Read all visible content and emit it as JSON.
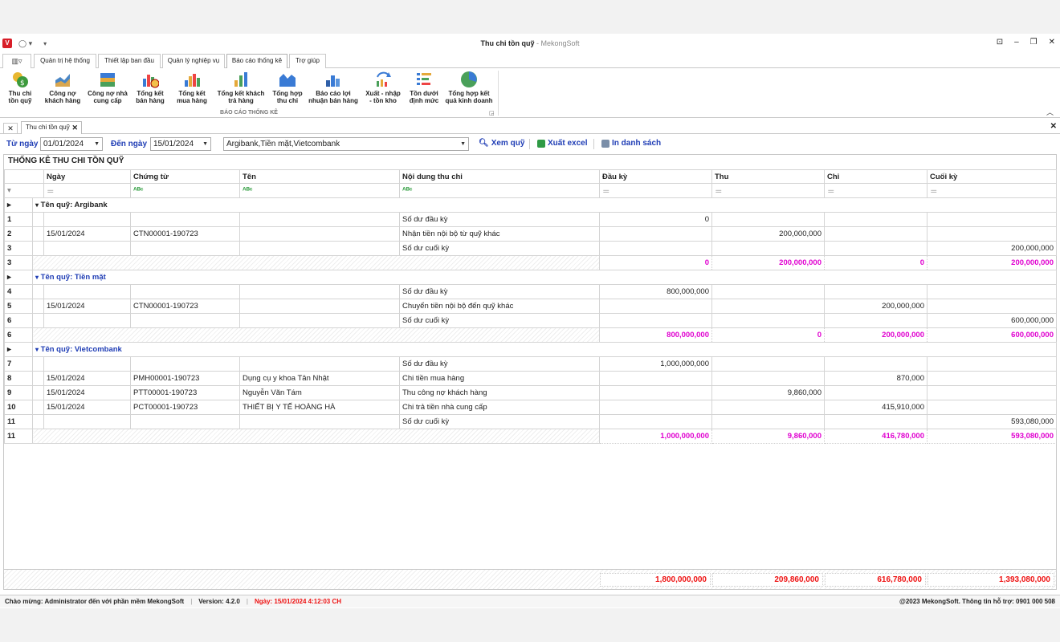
{
  "window": {
    "title": "Thu chi tồn quỹ",
    "app_name": "- MekongSoft"
  },
  "ribbon_tabs": [
    "Quản trị hệ thống",
    "Thiết lập ban đầu",
    "Quản lý nghiệp vụ",
    "Báo cáo thống kê",
    "Trợ giúp"
  ],
  "ribbon": {
    "group_label": "BÁO CÁO THỐNG KÊ",
    "buttons": [
      {
        "label": "Thu chi\ntồn quỹ"
      },
      {
        "label": "Công nợ\nkhách hàng"
      },
      {
        "label": "Công nợ nhà\ncung cấp"
      },
      {
        "label": "Tổng kết\nbán hàng"
      },
      {
        "label": "Tổng kết\nmua hàng"
      },
      {
        "label": "Tổng kết khách\ntrả hàng"
      },
      {
        "label": "Tổng hợp\nthu chi"
      },
      {
        "label": "Báo cáo lợi\nnhuận bán hàng"
      },
      {
        "label": "Xuất - nhập\n- tồn kho"
      },
      {
        "label": "Tồn dưới\nđịnh mức"
      },
      {
        "label": "Tổng hợp kết\nquả kinh doanh"
      }
    ]
  },
  "doc_tab": "Thu chi tồn quỹ",
  "filter": {
    "from_label": "Từ ngày",
    "from_value": "01/01/2024",
    "to_label": "Đến ngày",
    "to_value": "15/01/2024",
    "funds_value": "Argibank,Tiền mặt,Vietcombank",
    "view_label": "Xem quỹ",
    "excel_label": "Xuất excel",
    "print_label": "In danh sách"
  },
  "grid": {
    "title": "THỐNG KÊ THU CHI TỒN QUỸ",
    "columns": [
      "Ngày",
      "Chứng từ",
      "Tên",
      "Nội dung thu chi",
      "Đầu kỳ",
      "Thu",
      "Chi",
      "Cuối kỳ"
    ],
    "groups": [
      {
        "label": "Tên quỹ: Argibank",
        "rows": [
          {
            "n": "1",
            "date": "",
            "doc": "",
            "name": "",
            "content": "Số dư đầu kỳ",
            "open": "0",
            "in": "",
            "out": "",
            "close": ""
          },
          {
            "n": "2",
            "date": "15/01/2024",
            "doc": "CTN00001-190723",
            "name": "",
            "content": "Nhận tiền nội bộ từ quỹ khác",
            "open": "",
            "in": "200,000,000",
            "out": "",
            "close": ""
          },
          {
            "n": "3",
            "date": "",
            "doc": "",
            "name": "",
            "content": "Số dư cuối kỳ",
            "open": "",
            "in": "",
            "out": "",
            "close": "200,000,000"
          }
        ],
        "summary": {
          "n": "3",
          "open": "0",
          "in": "200,000,000",
          "out": "0",
          "close": "200,000,000"
        }
      },
      {
        "label": "Tên quỹ: Tiền mặt",
        "rows": [
          {
            "n": "4",
            "date": "",
            "doc": "",
            "name": "",
            "content": "Số dư đầu kỳ",
            "open": "800,000,000",
            "in": "",
            "out": "",
            "close": ""
          },
          {
            "n": "5",
            "date": "15/01/2024",
            "doc": "CTN00001-190723",
            "name": "",
            "content": "Chuyển tiền nội bộ đến quỹ khác",
            "open": "",
            "in": "",
            "out": "200,000,000",
            "close": ""
          },
          {
            "n": "6",
            "date": "",
            "doc": "",
            "name": "",
            "content": "Số dư cuối kỳ",
            "open": "",
            "in": "",
            "out": "",
            "close": "600,000,000"
          }
        ],
        "summary": {
          "n": "6",
          "open": "800,000,000",
          "in": "0",
          "out": "200,000,000",
          "close": "600,000,000"
        }
      },
      {
        "label": "Tên quỹ: Vietcombank",
        "rows": [
          {
            "n": "7",
            "date": "",
            "doc": "",
            "name": "",
            "content": "Số dư đầu kỳ",
            "open": "1,000,000,000",
            "in": "",
            "out": "",
            "close": ""
          },
          {
            "n": "8",
            "date": "15/01/2024",
            "doc": "PMH00001-190723",
            "name": "Dụng cụ y khoa Tân Nhật",
            "content": "Chi tiền mua hàng",
            "open": "",
            "in": "",
            "out": "870,000",
            "close": ""
          },
          {
            "n": "9",
            "date": "15/01/2024",
            "doc": "PTT00001-190723",
            "name": "Nguyễn Văn Tám",
            "content": "Thu công nợ khách hàng",
            "open": "",
            "in": "9,860,000",
            "out": "",
            "close": ""
          },
          {
            "n": "10",
            "date": "15/01/2024",
            "doc": "PCT00001-190723",
            "name": "THIẾT BỊ Y TẾ HOÀNG HÀ",
            "content": "Chi trả tiền nhà cung cấp",
            "open": "",
            "in": "",
            "out": "415,910,000",
            "close": ""
          },
          {
            "n": "11",
            "date": "",
            "doc": "",
            "name": "",
            "content": "Số dư cuối kỳ",
            "open": "",
            "in": "",
            "out": "",
            "close": "593,080,000"
          }
        ],
        "summary": {
          "n": "11",
          "open": "1,000,000,000",
          "in": "9,860,000",
          "out": "416,780,000",
          "close": "593,080,000"
        }
      }
    ],
    "totals": {
      "open": "1,800,000,000",
      "in": "209,860,000",
      "out": "616,780,000",
      "close": "1,393,080,000"
    }
  },
  "status": {
    "welcome": "Chào mừng: Administrator đến với phần mềm MekongSoft",
    "version": "Version: 4.2.0",
    "date": "Ngày: 15/01/2024 4:12:03 CH",
    "copyright": "@2023 MekongSoft. Thông tin hỗ trợ: 0901 000 508"
  }
}
